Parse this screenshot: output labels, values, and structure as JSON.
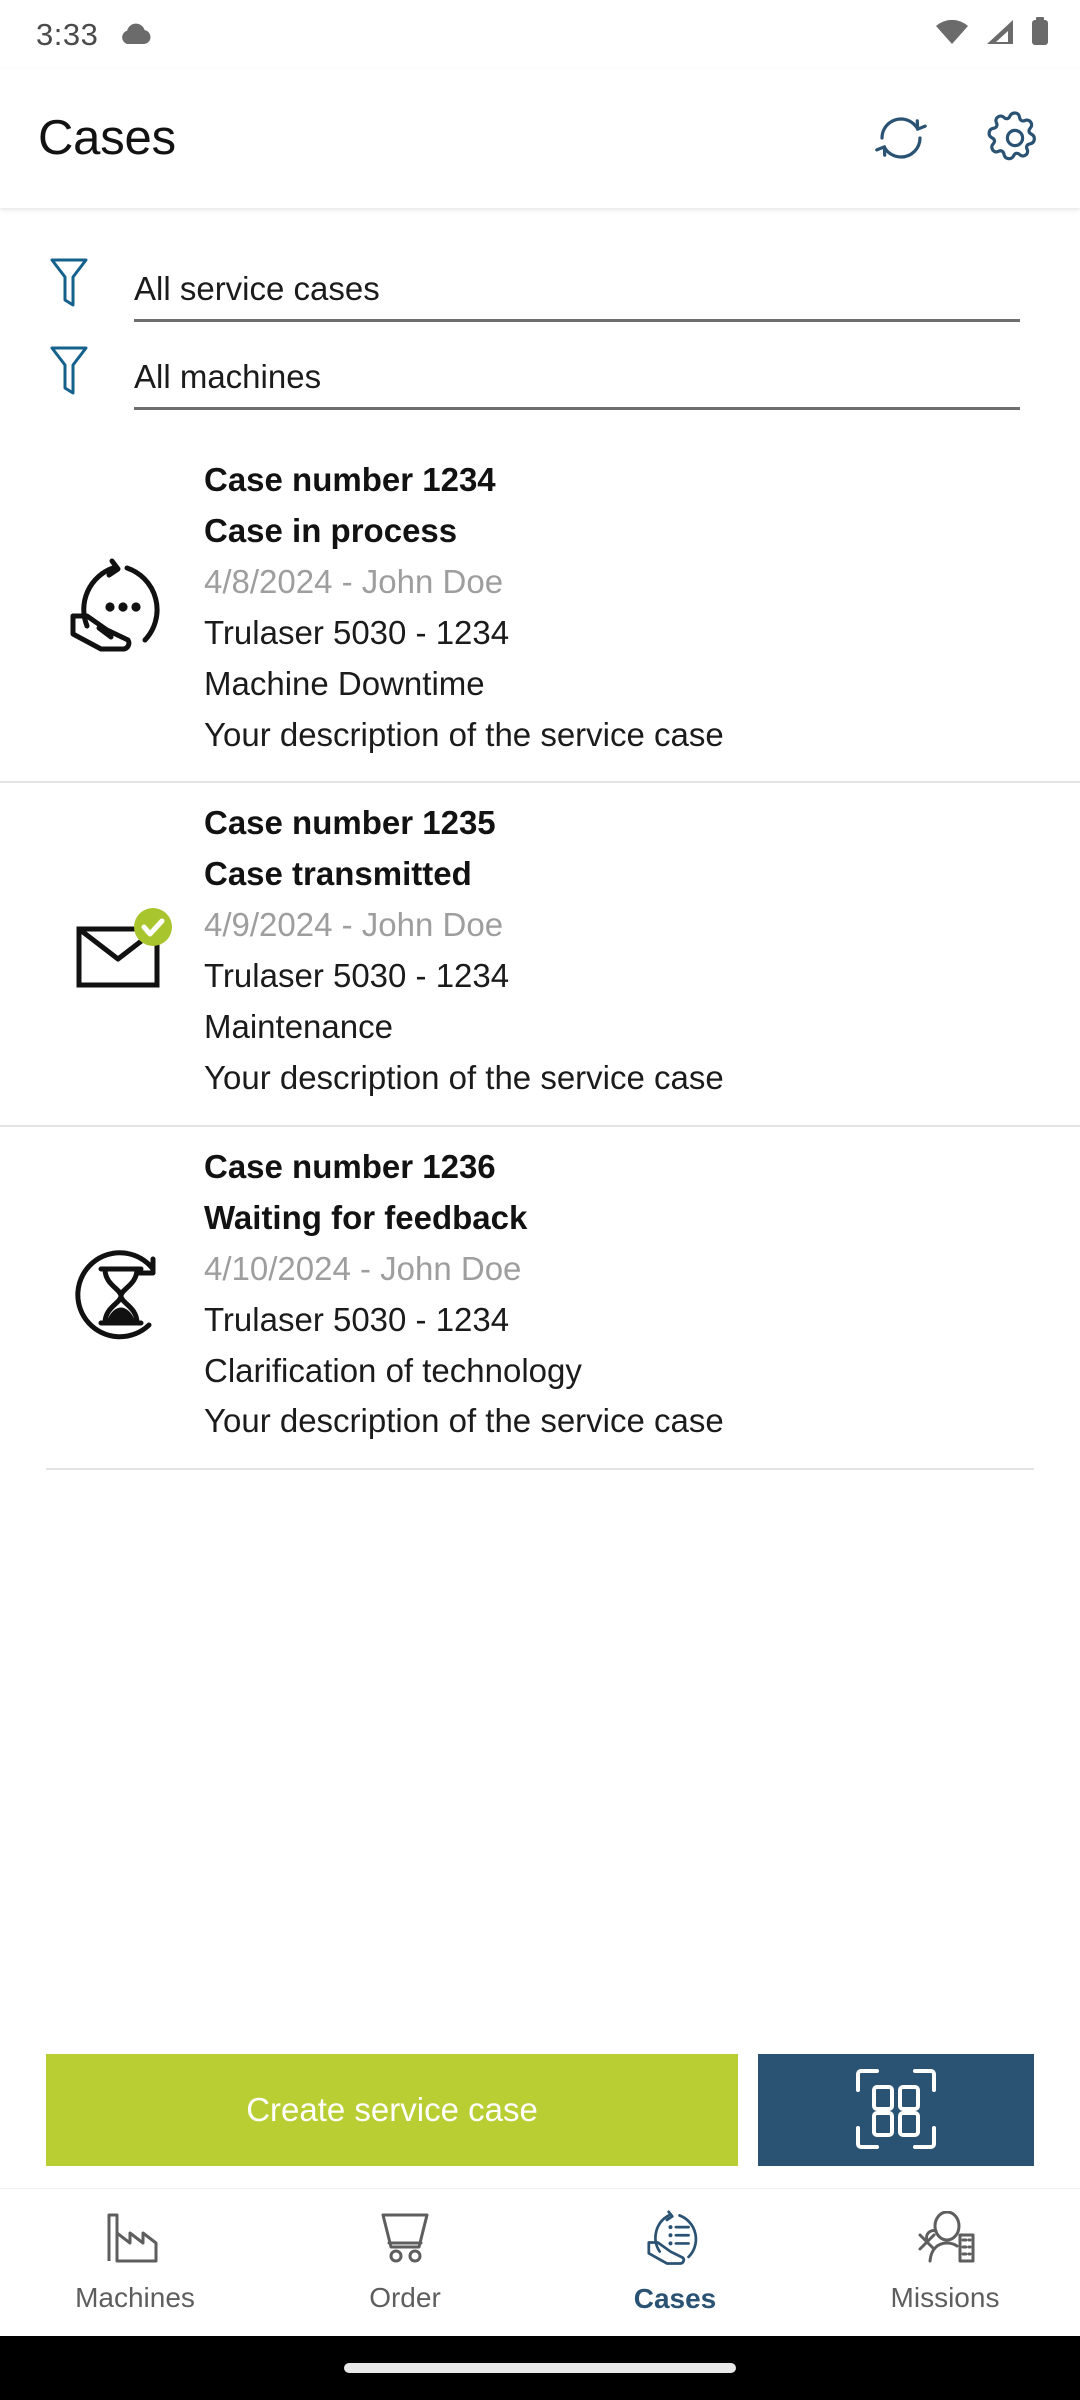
{
  "status_bar": {
    "time": "3:33",
    "icons": [
      "cloud-icon",
      "wifi-icon",
      "cellular-signal-icon",
      "battery-icon"
    ]
  },
  "app_bar": {
    "title": "Cases",
    "sync_label": "Synchronize",
    "settings_label": "Settings"
  },
  "filters": [
    {
      "name": "service-cases",
      "value": "All service cases",
      "placeholder": "All service cases"
    },
    {
      "name": "machines",
      "value": "All machines",
      "placeholder": "All machines"
    }
  ],
  "cases": [
    {
      "icon": "case-in-process-icon",
      "number": "Case number 1234",
      "status": "Case in process",
      "meta": "4/8/2024 - John Doe",
      "machine": "Trulaser 5030 - 1234",
      "category": "Machine Downtime",
      "description": "Your description of the service case"
    },
    {
      "icon": "case-transmitted-icon",
      "number": "Case number 1235",
      "status": "Case transmitted",
      "meta": "4/9/2024 - John Doe",
      "machine": "Trulaser 5030 - 1234",
      "category": "Maintenance",
      "description": "Your description of the service case"
    },
    {
      "icon": "waiting-for-feedback-icon",
      "number": "Case number 1236",
      "status": "Waiting for feedback",
      "meta": "4/10/2024 - John Doe",
      "machine": "Trulaser 5030 - 1234",
      "category": "Clarification of technology",
      "description": "Your description of the service case"
    }
  ],
  "actions": {
    "create_label": "Create service case",
    "scan_label": "Scan QR code"
  },
  "bottom_nav": [
    {
      "label": "Machines",
      "icon": "factory-icon",
      "active": false
    },
    {
      "label": "Order",
      "icon": "shopping-cart-icon",
      "active": false
    },
    {
      "label": "Cases",
      "icon": "hand-case-icon",
      "active": true
    },
    {
      "label": "Missions",
      "icon": "person-wrench-icon",
      "active": false
    }
  ],
  "colors": {
    "accent_green": "#b8ce33",
    "accent_blue": "#2a5272",
    "badge_green": "#a9c52e",
    "muted_text": "#9e9e9e",
    "divider": "#e3e3e3"
  }
}
